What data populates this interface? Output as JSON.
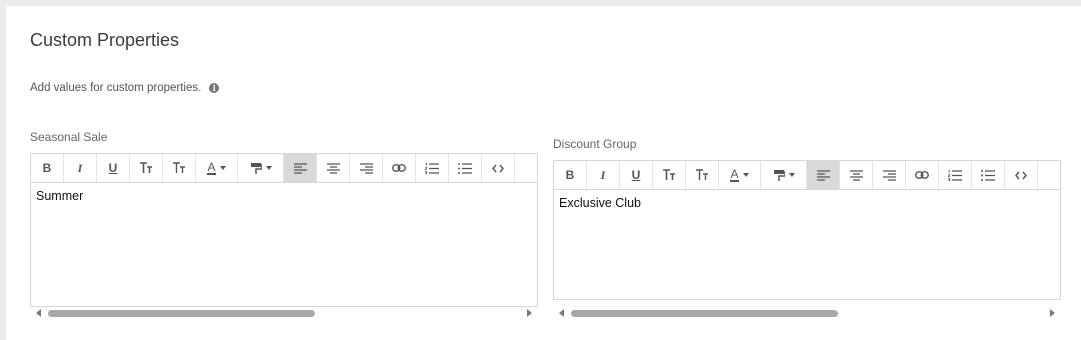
{
  "section": {
    "title": "Custom Properties",
    "description": "Add values for custom properties.",
    "info_icon_glyph": "i"
  },
  "toolbar_buttons": [
    {
      "name": "bold-button",
      "icon": "bold-icon",
      "glyph": "B"
    },
    {
      "name": "italic-button",
      "icon": "italic-icon",
      "glyph": "I"
    },
    {
      "name": "underline-button",
      "icon": "underline-icon",
      "glyph": "U"
    },
    {
      "name": "font-size-button",
      "icon": "font-size-icon"
    },
    {
      "name": "text-case-button",
      "icon": "text-case-icon"
    },
    {
      "name": "font-color-button",
      "icon": "font-color-icon",
      "glyph": "A"
    },
    {
      "name": "format-painter-button",
      "icon": "paint-format-icon"
    },
    {
      "name": "align-left-button",
      "icon": "align-left-icon",
      "active": true
    },
    {
      "name": "align-center-button",
      "icon": "align-center-icon"
    },
    {
      "name": "align-right-button",
      "icon": "align-right-icon"
    },
    {
      "name": "insert-link-button",
      "icon": "link-icon"
    },
    {
      "name": "ordered-list-button",
      "icon": "ordered-list-icon"
    },
    {
      "name": "bullet-list-button",
      "icon": "bullet-list-icon"
    },
    {
      "name": "source-code-button",
      "icon": "code-icon"
    }
  ],
  "fields": [
    {
      "label": "Seasonal Sale",
      "value": "Summer"
    },
    {
      "label": "Discount Group",
      "value": "Exclusive Club"
    }
  ],
  "colors": {
    "active_button_bg": "#d9d9d9",
    "scrollbar_thumb": "#a8a8a8",
    "border": "#d6d6d6"
  }
}
